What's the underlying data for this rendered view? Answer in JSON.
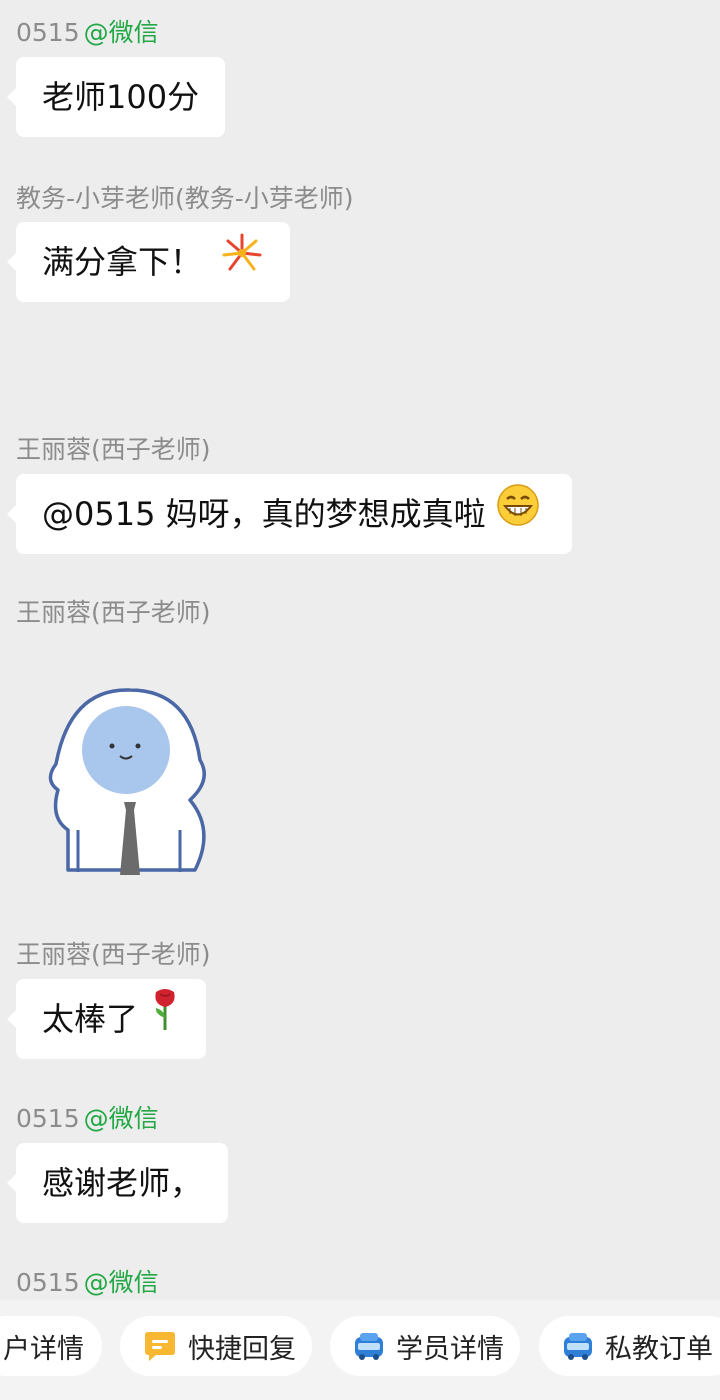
{
  "messages": [
    {
      "sender": "0515",
      "source": "@微信",
      "text": "老师100分"
    },
    {
      "sender": "教务-小芽老师(教务-小芽老师)",
      "text": "满分拿下！"
    },
    {
      "sender": "王丽蓉(西子老师)",
      "text": "@0515  妈呀，真的梦想成真啦"
    },
    {
      "sender": "王丽蓉(西子老师)"
    },
    {
      "sender": "王丽蓉(西子老师)",
      "text": "太棒了"
    },
    {
      "sender": "0515",
      "source": "@微信",
      "text": "感谢老师，"
    },
    {
      "sender": "0515",
      "source": "@微信"
    }
  ],
  "quick_actions": [
    {
      "label": "户详情"
    },
    {
      "label": "快捷回复",
      "icon": "quick-reply-icon"
    },
    {
      "label": "学员详情",
      "icon": "student-icon"
    },
    {
      "label": "私教订单",
      "icon": "order-icon"
    }
  ],
  "colors": {
    "background": "#ededed",
    "bubble": "#ffffff",
    "source_green": "#22a845",
    "reply_icon": "#f7b731"
  }
}
